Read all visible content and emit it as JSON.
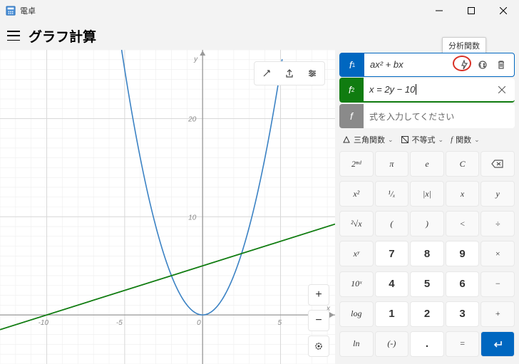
{
  "app": {
    "title": "電卓"
  },
  "header": {
    "title": "グラフ計算"
  },
  "tooltip": "分析関数",
  "functions": {
    "f1": {
      "label": "f",
      "sub": "1",
      "expr_html": "ax² + bx"
    },
    "f2": {
      "label": "f",
      "sub": "2",
      "expr_html": "x = 2y − 10"
    },
    "f3": {
      "label": "f",
      "placeholder": "式を入力してください"
    }
  },
  "toolbar2": {
    "trig": "三角関数",
    "ineq": "不等式",
    "func": "関数",
    "func_sym": "f"
  },
  "keypad": [
    [
      "2ⁿᵈ",
      "π",
      "e",
      "C",
      "⌫"
    ],
    [
      "x²",
      "¹/ₓ",
      "|x|",
      "x",
      "y"
    ],
    [
      "²√x",
      "(",
      ")",
      "<",
      "÷"
    ],
    [
      "xʸ",
      "7",
      "8",
      "9",
      "×"
    ],
    [
      "10ˣ",
      "4",
      "5",
      "6",
      "−"
    ],
    [
      "log",
      "1",
      "2",
      "3",
      "+"
    ],
    [
      "ln",
      "(-)",
      ".",
      "=",
      "↵"
    ]
  ],
  "keypad_types": [
    [
      "fn",
      "fn",
      "fn",
      "fn",
      "fn"
    ],
    [
      "fn",
      "fn",
      "fn",
      "fn",
      "fn"
    ],
    [
      "fn",
      "fn",
      "fn",
      "fn",
      "fn"
    ],
    [
      "fn",
      "num",
      "num",
      "num",
      "fn"
    ],
    [
      "fn",
      "num",
      "num",
      "num",
      "fn"
    ],
    [
      "fn",
      "num",
      "num",
      "num",
      "fn"
    ],
    [
      "fn",
      "fn",
      "num",
      "fn",
      "enter"
    ]
  ],
  "chart_data": {
    "type": "line",
    "xlabel": "x",
    "ylabel": "y",
    "xlim": [
      -13,
      8.5
    ],
    "ylim": [
      -5,
      27
    ],
    "xticks": [
      -10,
      -5,
      0,
      5
    ],
    "yticks": [
      10,
      20
    ],
    "gridlines": true,
    "series": [
      {
        "name": "f1",
        "color": "#3b82c4",
        "equation": "y = x^2",
        "type": "parabola"
      },
      {
        "name": "f2",
        "color": "#107c10",
        "equation": "x = 2y - 10",
        "slope": 0.5,
        "intercept": 5,
        "type": "line"
      }
    ]
  }
}
